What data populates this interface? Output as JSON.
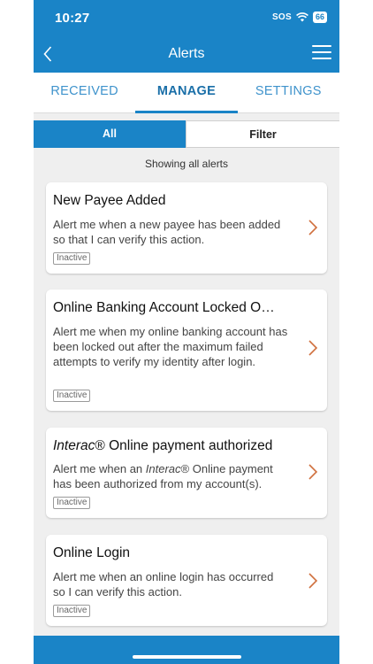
{
  "status": {
    "time": "10:27",
    "sos": "SOS",
    "battery": "66"
  },
  "header": {
    "title": "Alerts"
  },
  "tabs": [
    {
      "label": "RECEIVED",
      "active": false
    },
    {
      "label": "MANAGE",
      "active": true
    },
    {
      "label": "SETTINGS",
      "active": false
    }
  ],
  "segment": {
    "all": "All",
    "filter": "Filter"
  },
  "showing": "Showing all alerts",
  "cards": [
    {
      "title_em": "",
      "title": "New Payee Added",
      "desc_pre": "Alert me when a new payee has been added so that I can verify this action.",
      "desc_em": "",
      "desc_post": "",
      "status": "Inactive"
    },
    {
      "title_em": "",
      "title": "Online Banking Account Locked O…",
      "desc_pre": "Alert me when my online banking account has been locked out after the maximum failed attempts to verify my identity after login.",
      "desc_em": "",
      "desc_post": "",
      "status": "Inactive"
    },
    {
      "title_em": "Interac",
      "title": "® Online payment authorized",
      "desc_pre": "Alert me when an ",
      "desc_em": "Interac",
      "desc_post": "® Online payment has been authorized from my account(s).",
      "status": "Inactive"
    },
    {
      "title_em": "",
      "title": "Online Login",
      "desc_pre": "Alert me when an online login has occurred so I can verify this action.",
      "desc_em": "",
      "desc_post": "",
      "status": "Inactive"
    }
  ],
  "colors": {
    "primary": "#1a84c7",
    "chevron": "#d0703e"
  }
}
